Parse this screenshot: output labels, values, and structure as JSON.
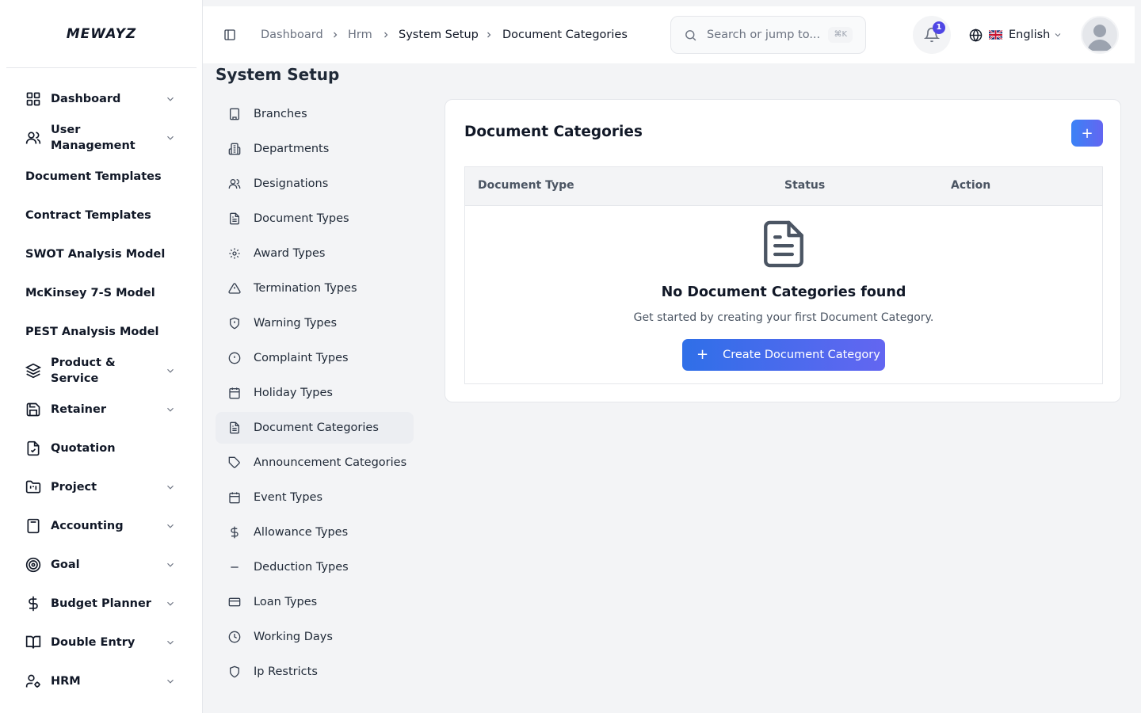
{
  "app": {
    "logo": "MEWAYZ"
  },
  "sidebar": {
    "items": [
      {
        "label": "Dashboard",
        "icon": "grid-icon",
        "has_children": true
      },
      {
        "label": "User Management",
        "icon": "users-icon",
        "has_children": true
      },
      {
        "label": "Document Templates",
        "icon": "",
        "has_children": false
      },
      {
        "label": "Contract Templates",
        "icon": "",
        "has_children": false
      },
      {
        "label": "SWOT Analysis Model",
        "icon": "",
        "has_children": false
      },
      {
        "label": "McKinsey 7-S Model",
        "icon": "",
        "has_children": false
      },
      {
        "label": "PEST Analysis Model",
        "icon": "",
        "has_children": false
      },
      {
        "label": "Product & Service",
        "icon": "layers-icon",
        "has_children": true
      },
      {
        "label": "Retainer",
        "icon": "save-icon",
        "has_children": true
      },
      {
        "label": "Quotation",
        "icon": "file-check-icon",
        "has_children": false
      },
      {
        "label": "Project",
        "icon": "folder-kanban-icon",
        "has_children": true
      },
      {
        "label": "Accounting",
        "icon": "calculator-icon",
        "has_children": true
      },
      {
        "label": "Goal",
        "icon": "target-icon",
        "has_children": true
      },
      {
        "label": "Budget Planner",
        "icon": "dollar-icon",
        "has_children": true
      },
      {
        "label": "Double Entry",
        "icon": "book-open-icon",
        "has_children": true
      },
      {
        "label": "HRM",
        "icon": "user-cog-icon",
        "has_children": true
      }
    ]
  },
  "header": {
    "breadcrumb": [
      "Dashboard",
      "Hrm",
      "System Setup",
      "Document Categories"
    ],
    "search": {
      "placeholder": "Search or jump to...",
      "shortcut": "⌘K"
    },
    "notifications": {
      "count": "1"
    },
    "language": {
      "label": "English",
      "flag": "uk-flag"
    }
  },
  "page": {
    "title": "System Setup",
    "submenu": [
      {
        "label": "Branches",
        "icon": "building-icon"
      },
      {
        "label": "Departments",
        "icon": "building-2-icon"
      },
      {
        "label": "Designations",
        "icon": "users-icon"
      },
      {
        "label": "Document Types",
        "icon": "file-text-icon"
      },
      {
        "label": "Award Types",
        "icon": "award-icon"
      },
      {
        "label": "Termination Types",
        "icon": "alert-triangle-icon"
      },
      {
        "label": "Warning Types",
        "icon": "shield-alert-icon"
      },
      {
        "label": "Complaint Types",
        "icon": "alert-circle-icon"
      },
      {
        "label": "Holiday Types",
        "icon": "calendar-icon"
      },
      {
        "label": "Document Categories",
        "icon": "file-text-icon",
        "active": true
      },
      {
        "label": "Announcement Categories",
        "icon": "tag-icon"
      },
      {
        "label": "Event Types",
        "icon": "calendar-icon"
      },
      {
        "label": "Allowance Types",
        "icon": "dollar-icon"
      },
      {
        "label": "Deduction Types",
        "icon": "minus-icon"
      },
      {
        "label": "Loan Types",
        "icon": "credit-card-icon"
      },
      {
        "label": "Working Days",
        "icon": "clock-icon"
      },
      {
        "label": "Ip Restricts",
        "icon": "shield-icon"
      }
    ]
  },
  "card": {
    "title": "Document Categories",
    "add_label": "+",
    "table": {
      "columns": [
        "Document Type",
        "Status",
        "Action"
      ]
    },
    "empty_state": {
      "title": "No Document Categories found",
      "subtitle": "Get started by creating your first Document Category.",
      "button_icon": "+",
      "button_label": "Create Document Category"
    }
  },
  "colors": {
    "accent": "#3b82f6",
    "accent_end": "#6366f1",
    "badge": "#4f46e5",
    "active_bg": "#eceef2"
  }
}
